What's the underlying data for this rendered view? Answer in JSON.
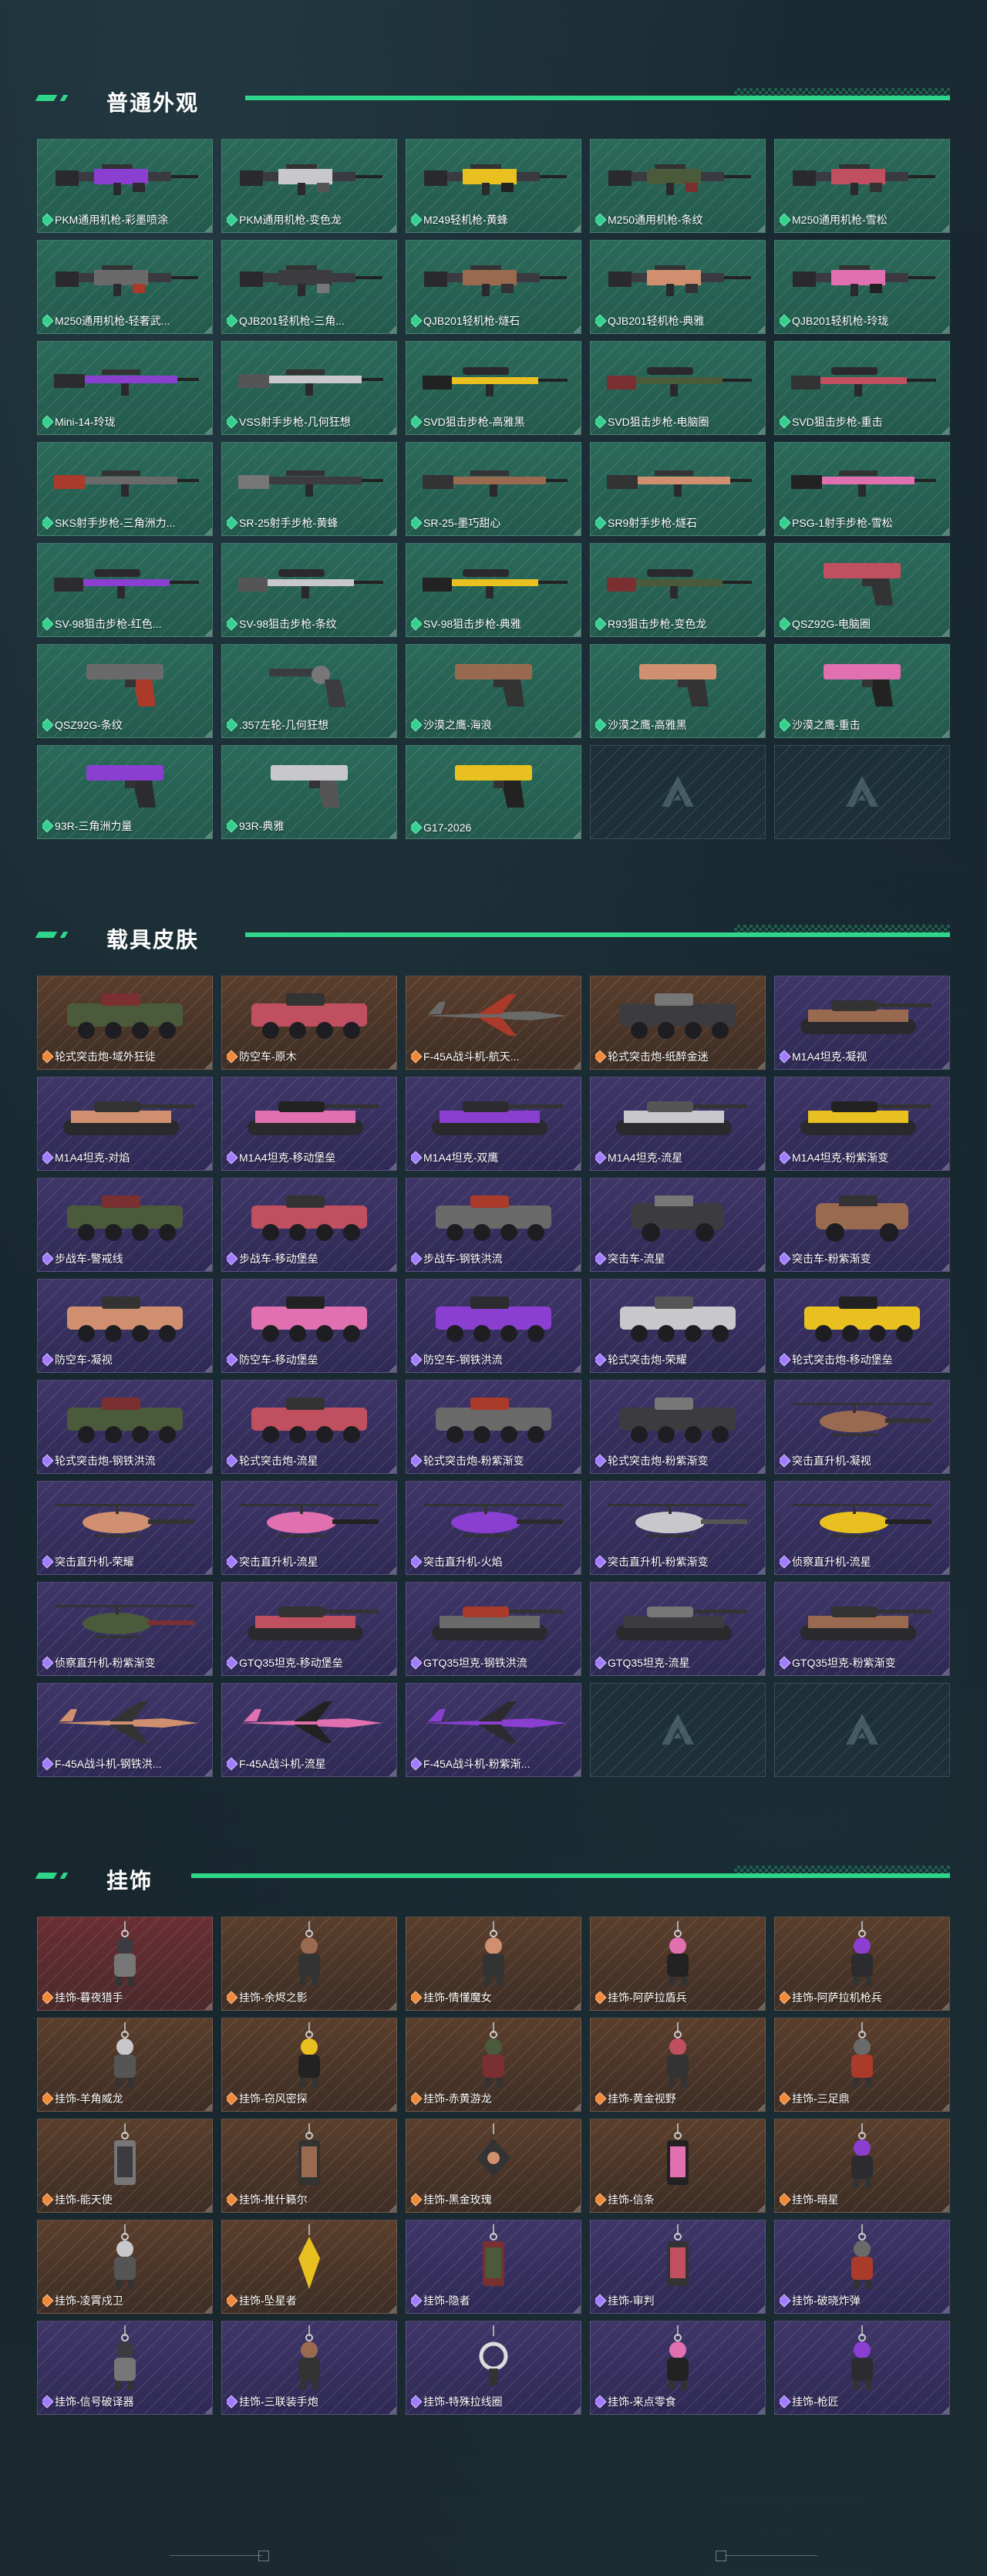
{
  "sections": [
    {
      "title": "普通外观",
      "items": [
        {
          "label": "PKM通用机枪-彩墨喷涂",
          "rarity": "green",
          "icon": "machine-gun-icon"
        },
        {
          "label": "PKM通用机枪-变色龙",
          "rarity": "green",
          "icon": "machine-gun-icon"
        },
        {
          "label": "M249轻机枪-黄蜂",
          "rarity": "green",
          "icon": "machine-gun-icon"
        },
        {
          "label": "M250通用机枪-条纹",
          "rarity": "green",
          "icon": "machine-gun-icon"
        },
        {
          "label": "M250通用机枪-雪松",
          "rarity": "green",
          "icon": "machine-gun-icon"
        },
        {
          "label": "M250通用机枪-轻奢武...",
          "rarity": "green",
          "icon": "machine-gun-icon"
        },
        {
          "label": "QJB201轻机枪-三角...",
          "rarity": "green",
          "icon": "machine-gun-icon"
        },
        {
          "label": "QJB201轻机枪-燧石",
          "rarity": "green",
          "icon": "machine-gun-icon"
        },
        {
          "label": "QJB201轻机枪-典雅",
          "rarity": "green",
          "icon": "machine-gun-icon"
        },
        {
          "label": "QJB201轻机枪-玲珑",
          "rarity": "green",
          "icon": "machine-gun-icon"
        },
        {
          "label": "Mini-14-玲珑",
          "rarity": "green",
          "icon": "rifle-icon"
        },
        {
          "label": "VSS射手步枪-几何狂想",
          "rarity": "green",
          "icon": "rifle-icon"
        },
        {
          "label": "SVD狙击步枪-高雅黑",
          "rarity": "green",
          "icon": "sniper-rifle-icon"
        },
        {
          "label": "SVD狙击步枪-电脑圈",
          "rarity": "green",
          "icon": "sniper-rifle-icon"
        },
        {
          "label": "SVD狙击步枪-重击",
          "rarity": "green",
          "icon": "sniper-rifle-icon"
        },
        {
          "label": "SKS射手步枪-三角洲力...",
          "rarity": "green",
          "icon": "rifle-icon"
        },
        {
          "label": "SR-25射手步枪-黄蜂",
          "rarity": "green",
          "icon": "rifle-icon"
        },
        {
          "label": "SR-25-墨巧甜心",
          "rarity": "green",
          "icon": "rifle-icon"
        },
        {
          "label": "SR9射手步枪-燧石",
          "rarity": "green",
          "icon": "rifle-icon"
        },
        {
          "label": "PSG-1射手步枪-雪松",
          "rarity": "green",
          "icon": "rifle-icon"
        },
        {
          "label": "SV-98狙击步枪-红色...",
          "rarity": "green",
          "icon": "sniper-rifle-icon"
        },
        {
          "label": "SV-98狙击步枪-条纹",
          "rarity": "green",
          "icon": "sniper-rifle-icon"
        },
        {
          "label": "SV-98狙击步枪-典雅",
          "rarity": "green",
          "icon": "sniper-rifle-icon"
        },
        {
          "label": "R93狙击步枪-变色龙",
          "rarity": "green",
          "icon": "sniper-rifle-icon"
        },
        {
          "label": "QSZ92G-电脑圈",
          "rarity": "green",
          "icon": "pistol-icon"
        },
        {
          "label": "QSZ92G-条纹",
          "rarity": "green",
          "icon": "pistol-icon"
        },
        {
          "label": ".357左轮-几何狂想",
          "rarity": "green",
          "icon": "revolver-icon"
        },
        {
          "label": "沙漠之鹰-海浪",
          "rarity": "green",
          "icon": "pistol-icon"
        },
        {
          "label": "沙漠之鹰-高雅黑",
          "rarity": "green",
          "icon": "pistol-icon"
        },
        {
          "label": "沙漠之鹰-重击",
          "rarity": "green",
          "icon": "pistol-icon"
        },
        {
          "label": "93R-三角洲力量",
          "rarity": "green",
          "icon": "pistol-icon"
        },
        {
          "label": "93R-典雅",
          "rarity": "green",
          "icon": "pistol-icon"
        },
        {
          "label": "G17-2026",
          "rarity": "green",
          "icon": "pistol-icon"
        },
        {
          "label": "",
          "rarity": "empty",
          "icon": "placeholder-logo-icon"
        },
        {
          "label": "",
          "rarity": "empty",
          "icon": "placeholder-logo-icon"
        }
      ]
    },
    {
      "title": "载具皮肤",
      "items": [
        {
          "label": "轮式突击炮-域外狂徒",
          "rarity": "orange",
          "icon": "armored-car-icon"
        },
        {
          "label": "防空车-原木",
          "rarity": "orange",
          "icon": "armored-car-icon"
        },
        {
          "label": "F-45A战斗机-航天...",
          "rarity": "orange",
          "icon": "jet-icon"
        },
        {
          "label": "轮式突击炮-纸醉金迷",
          "rarity": "orange",
          "icon": "armored-car-icon"
        },
        {
          "label": "M1A4坦克-凝视",
          "rarity": "purple",
          "icon": "tank-icon"
        },
        {
          "label": "M1A4坦克-对焰",
          "rarity": "purple",
          "icon": "tank-icon"
        },
        {
          "label": "M1A4坦克-移动堡垒",
          "rarity": "purple",
          "icon": "tank-icon"
        },
        {
          "label": "M1A4坦克-双鹰",
          "rarity": "purple",
          "icon": "tank-icon"
        },
        {
          "label": "M1A4坦克-流星",
          "rarity": "purple",
          "icon": "tank-icon"
        },
        {
          "label": "M1A4坦克-粉紫渐变",
          "rarity": "purple",
          "icon": "tank-icon"
        },
        {
          "label": "步战车-警戒线",
          "rarity": "purple",
          "icon": "armored-car-icon"
        },
        {
          "label": "步战车-移动堡垒",
          "rarity": "purple",
          "icon": "armored-car-icon"
        },
        {
          "label": "步战车-钢铁洪流",
          "rarity": "purple",
          "icon": "armored-car-icon"
        },
        {
          "label": "突击车-流星",
          "rarity": "purple",
          "icon": "jeep-icon"
        },
        {
          "label": "突击车-粉紫渐变",
          "rarity": "purple",
          "icon": "jeep-icon"
        },
        {
          "label": "防空车-凝视",
          "rarity": "purple",
          "icon": "armored-car-icon"
        },
        {
          "label": "防空车-移动堡垒",
          "rarity": "purple",
          "icon": "armored-car-icon"
        },
        {
          "label": "防空车-钢铁洪流",
          "rarity": "purple",
          "icon": "armored-car-icon"
        },
        {
          "label": "轮式突击炮-荣耀",
          "rarity": "purple",
          "icon": "armored-car-icon"
        },
        {
          "label": "轮式突击炮-移动堡垒",
          "rarity": "purple",
          "icon": "armored-car-icon"
        },
        {
          "label": "轮式突击炮-钢铁洪流",
          "rarity": "purple",
          "icon": "armored-car-icon"
        },
        {
          "label": "轮式突击炮-流星",
          "rarity": "purple",
          "icon": "armored-car-icon"
        },
        {
          "label": "轮式突击炮-粉紫渐变",
          "rarity": "purple",
          "icon": "armored-car-icon"
        },
        {
          "label": "轮式突击炮-粉紫渐变",
          "rarity": "purple",
          "icon": "armored-car-icon"
        },
        {
          "label": "突击直升机-凝视",
          "rarity": "purple",
          "icon": "helicopter-icon"
        },
        {
          "label": "突击直升机-荣耀",
          "rarity": "purple",
          "icon": "helicopter-icon"
        },
        {
          "label": "突击直升机-流星",
          "rarity": "purple",
          "icon": "helicopter-icon"
        },
        {
          "label": "突击直升机-火焰",
          "rarity": "purple",
          "icon": "helicopter-icon"
        },
        {
          "label": "突击直升机-粉紫渐变",
          "rarity": "purple",
          "icon": "helicopter-icon"
        },
        {
          "label": "侦察直升机-流星",
          "rarity": "purple",
          "icon": "helicopter-icon"
        },
        {
          "label": "侦察直升机-粉紫渐变",
          "rarity": "purple",
          "icon": "helicopter-icon"
        },
        {
          "label": "GTQ35坦克-移动堡垒",
          "rarity": "purple",
          "icon": "tank-icon"
        },
        {
          "label": "GTQ35坦克-钢铁洪流",
          "rarity": "purple",
          "icon": "tank-icon"
        },
        {
          "label": "GTQ35坦克-流星",
          "rarity": "purple",
          "icon": "tank-icon"
        },
        {
          "label": "GTQ35坦克-粉紫渐变",
          "rarity": "purple",
          "icon": "tank-icon"
        },
        {
          "label": "F-45A战斗机-钢铁洪...",
          "rarity": "purple",
          "icon": "jet-icon"
        },
        {
          "label": "F-45A战斗机-流星",
          "rarity": "purple",
          "icon": "jet-icon"
        },
        {
          "label": "F-45A战斗机-粉紫渐...",
          "rarity": "purple",
          "icon": "jet-icon"
        },
        {
          "label": "",
          "rarity": "empty",
          "icon": "placeholder-logo-icon"
        },
        {
          "label": "",
          "rarity": "empty",
          "icon": "placeholder-logo-icon"
        }
      ]
    },
    {
      "title": "挂饰",
      "items": [
        {
          "label": "挂饰-暮夜猎手",
          "rarity": "red",
          "icon": "charm-figure-icon"
        },
        {
          "label": "挂饰-余烬之影",
          "rarity": "orange",
          "icon": "charm-figure-icon"
        },
        {
          "label": "挂饰-情懂魔女",
          "rarity": "orange",
          "icon": "charm-figure-icon"
        },
        {
          "label": "挂饰-阿萨拉盾兵",
          "rarity": "orange",
          "icon": "charm-figure-icon"
        },
        {
          "label": "挂饰-阿萨拉机枪兵",
          "rarity": "orange",
          "icon": "charm-figure-icon"
        },
        {
          "label": "挂饰-羊角威龙",
          "rarity": "orange",
          "icon": "charm-figure-icon"
        },
        {
          "label": "挂饰-窃风密探",
          "rarity": "orange",
          "icon": "charm-figure-icon"
        },
        {
          "label": "挂饰-赤黄游龙",
          "rarity": "orange",
          "icon": "charm-figure-icon"
        },
        {
          "label": "挂饰-黄金视野",
          "rarity": "orange",
          "icon": "charm-figure-icon"
        },
        {
          "label": "挂饰-三足鼎",
          "rarity": "orange",
          "icon": "charm-figure-icon"
        },
        {
          "label": "挂饰-能天使",
          "rarity": "orange",
          "icon": "charm-tag-icon"
        },
        {
          "label": "挂饰-推什籁尔",
          "rarity": "orange",
          "icon": "charm-tag-icon"
        },
        {
          "label": "挂饰-黑金玫瑰",
          "rarity": "orange",
          "icon": "charm-diamond-icon"
        },
        {
          "label": "挂饰-信条",
          "rarity": "orange",
          "icon": "charm-tag-icon"
        },
        {
          "label": "挂饰-暗星",
          "rarity": "orange",
          "icon": "charm-figure-icon"
        },
        {
          "label": "挂饰-凌霄戍卫",
          "rarity": "orange",
          "icon": "charm-figure-icon"
        },
        {
          "label": "挂饰-坠星者",
          "rarity": "orange",
          "icon": "charm-crystal-icon"
        },
        {
          "label": "挂饰-隐者",
          "rarity": "purple",
          "icon": "charm-tag-icon"
        },
        {
          "label": "挂饰-审判",
          "rarity": "purple",
          "icon": "charm-tag-icon"
        },
        {
          "label": "挂饰-破晓炸弹",
          "rarity": "purple",
          "icon": "charm-figure-icon"
        },
        {
          "label": "挂饰-信号破译器",
          "rarity": "purple",
          "icon": "charm-figure-icon"
        },
        {
          "label": "挂饰-三联装手炮",
          "rarity": "purple",
          "icon": "charm-figure-icon"
        },
        {
          "label": "挂饰-特殊拉线圈",
          "rarity": "purple",
          "icon": "charm-ring-icon"
        },
        {
          "label": "挂饰-来点零食",
          "rarity": "purple",
          "icon": "charm-figure-icon"
        },
        {
          "label": "挂饰-枪匠",
          "rarity": "purple",
          "icon": "charm-figure-icon"
        }
      ]
    }
  ]
}
